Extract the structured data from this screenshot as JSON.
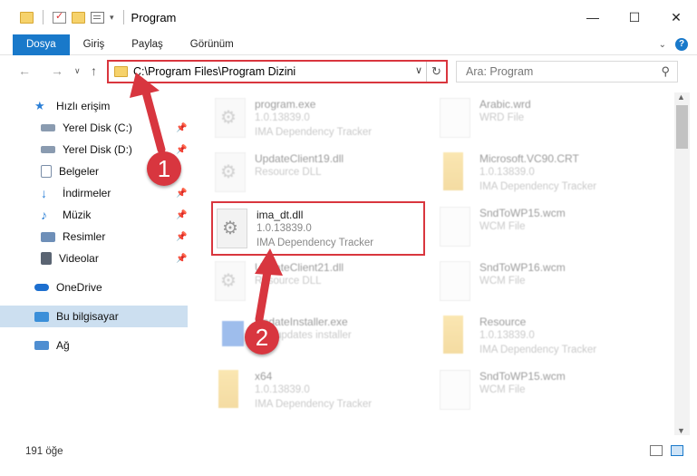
{
  "window": {
    "title": "Program"
  },
  "ribbon": {
    "tabs": [
      "Dosya",
      "Giriş",
      "Paylaş",
      "Görünüm"
    ]
  },
  "address": {
    "path": "C:\\Program Files\\Program Dizini"
  },
  "search": {
    "placeholder": "Ara: Program"
  },
  "sidebar": {
    "items": [
      {
        "label": "Hızlı erişim",
        "icon": "star-icon"
      },
      {
        "label": "Yerel Disk (C:)",
        "icon": "drive-icon"
      },
      {
        "label": "Yerel Disk (D:)",
        "icon": "drive-icon"
      },
      {
        "label": "Belgeler",
        "icon": "documents-icon"
      },
      {
        "label": "İndirmeler",
        "icon": "download-icon"
      },
      {
        "label": "Müzik",
        "icon": "music-icon"
      },
      {
        "label": "Resimler",
        "icon": "pictures-icon"
      },
      {
        "label": "Videolar",
        "icon": "videos-icon"
      },
      {
        "label": "OneDrive",
        "icon": "cloud-icon"
      },
      {
        "label": "Bu bilgisayar",
        "icon": "computer-icon"
      },
      {
        "label": "Ağ",
        "icon": "network-icon"
      }
    ]
  },
  "files": {
    "left": [
      {
        "name": "program.exe",
        "line1": "1.0.13839.0",
        "line2": "IMA Dependency Tracker"
      },
      {
        "name": "UpdateClient19.dll",
        "line1": "Resource DLL",
        "line2": ""
      },
      {
        "name": "ima_dt.dll",
        "line1": "1.0.13839.0",
        "line2": "IMA Dependency Tracker"
      },
      {
        "name": "UpdateClient21.dll",
        "line1": "Resource DLL",
        "line2": ""
      },
      {
        "name": "UpdateInstaller.exe",
        "line1": "IMF updates installer",
        "line2": ""
      },
      {
        "name": "x64",
        "line1": "1.0.13839.0",
        "line2": "IMA Dependency Tracker"
      }
    ],
    "right": [
      {
        "name": "Arabic.wrd",
        "line1": "WRD File",
        "line2": ""
      },
      {
        "name": "Microsoft.VC90.CRT",
        "line1": "1.0.13839.0",
        "line2": "IMA Dependency Tracker"
      },
      {
        "name": "SndToWP15.wcm",
        "line1": "WCM File",
        "line2": ""
      },
      {
        "name": "SndToWP16.wcm",
        "line1": "WCM File",
        "line2": ""
      },
      {
        "name": "Resource",
        "line1": "1.0.13839.0",
        "line2": "IMA Dependency Tracker"
      },
      {
        "name": "SndToWP15.wcm",
        "line1": "WCM File",
        "line2": ""
      }
    ]
  },
  "status": {
    "count": "191 öğe"
  },
  "callouts": [
    "1",
    "2"
  ],
  "colors": {
    "accent": "#1979ca",
    "highlight": "#d9363e"
  }
}
